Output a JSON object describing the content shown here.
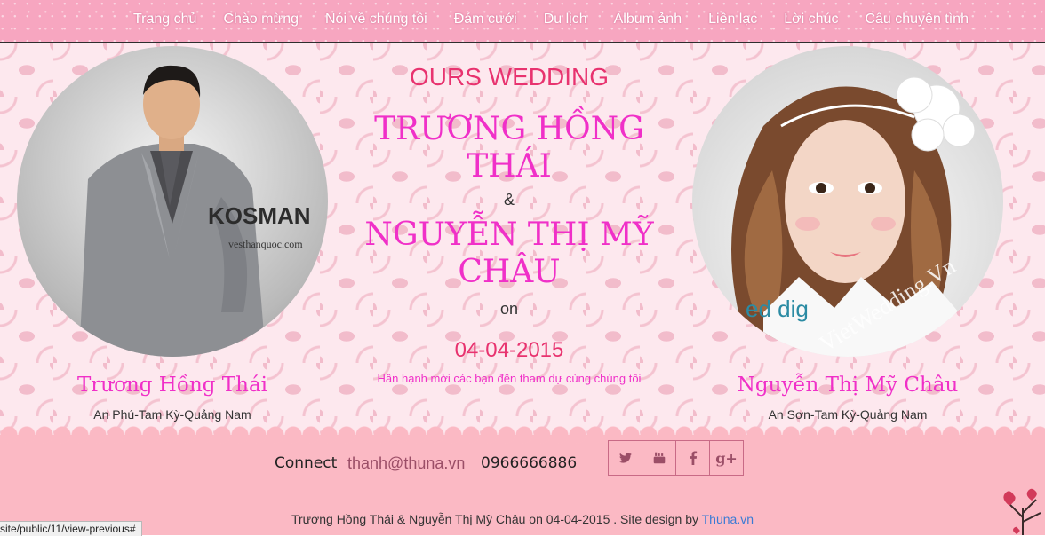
{
  "nav": {
    "items": [
      "Trang chủ",
      "Chào mừng",
      "Nói về chúng tôi",
      "Đám cưới",
      "Du lịch",
      "Album ảnh",
      "Liên lạc",
      "Lời chúc",
      "Câu chuyện tình"
    ]
  },
  "hero": {
    "heading": "OURS WEDDING",
    "groom_name": "TRƯƠNG HỒNG THÁI",
    "ampersand": "&",
    "bride_name": "NGUYỄN THỊ MỸ CHÂU",
    "on": "on",
    "date": "04-04-2015",
    "invite": "Hân hạnh mời các bạn đến tham dự cùng chúng tôi",
    "groom": {
      "name": "Trương Hồng Thái",
      "address": "An Phú-Tam Kỳ-Quảng Nam",
      "photo_text": "KOSMAN",
      "photo_subtext": "vesthanquoc.com"
    },
    "bride": {
      "name": "Nguyễn Thị Mỹ Châu",
      "address": "An Sơn-Tam Kỳ-Quảng Nam",
      "watermark": "VietWedding.Vn",
      "photo_logo": "ed dig"
    }
  },
  "footer": {
    "connect_label": "Connect",
    "email": "thanh@thuna.vn",
    "phone": "0966666886",
    "social": [
      "twitter-icon",
      "youtube-icon",
      "facebook-icon",
      "google-plus-icon"
    ],
    "credit_text": "Trương Hồng Thái & Nguyễn Thị Mỹ Châu on 04-04-2015 . Site design by ",
    "credit_link": "Thuna.vn"
  },
  "status_bar": "site/public/11/view-previous#",
  "colors": {
    "nav_bg": "#f7a6c0",
    "accent_pink": "#f030c8",
    "heading_red": "#e8336f",
    "footer_bg": "#fbb9c4"
  }
}
